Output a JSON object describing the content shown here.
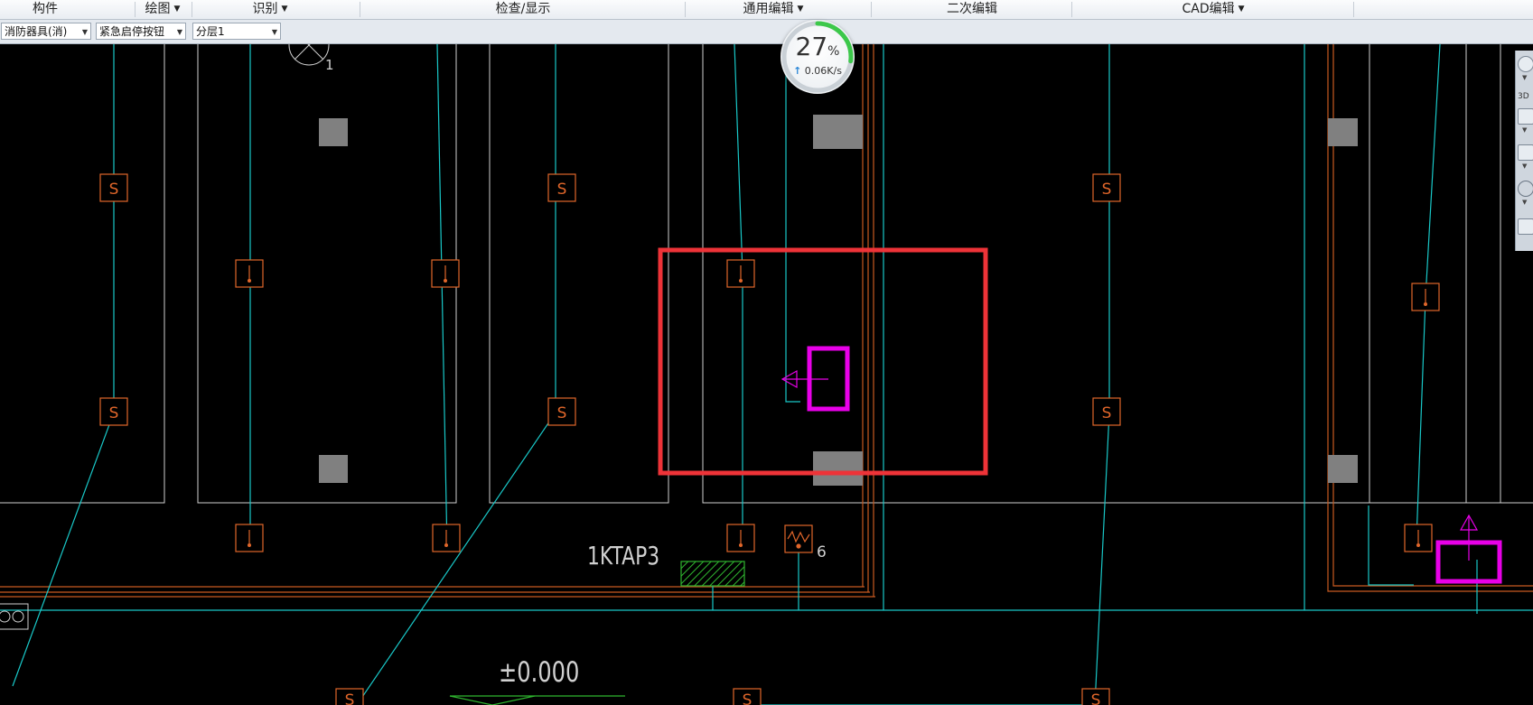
{
  "menubar": {
    "items": [
      {
        "label": "构件",
        "has_arrow": false
      },
      {
        "label": "绘图",
        "has_arrow": true
      },
      {
        "label": "识别",
        "has_arrow": true
      },
      {
        "label": "检查/显示",
        "has_arrow": false
      },
      {
        "label": "通用编辑",
        "has_arrow": true
      },
      {
        "label": "二次编辑",
        "has_arrow": false
      },
      {
        "label": "CAD编辑",
        "has_arrow": true
      }
    ]
  },
  "toolbar": {
    "component_type": "消防器具(消)",
    "component_name": "紧急启停按钮",
    "layer": "分层1"
  },
  "network_widget": {
    "percent": "27",
    "percent_unit": "%",
    "upload_speed": "0.06K/s"
  },
  "right_panel": {
    "label_3d": "3D"
  },
  "drawing": {
    "labels": {
      "panel_tag": "1KTAP3",
      "elevation": "±0.000",
      "index_number": "6",
      "axis_number": "1"
    },
    "symbols": {
      "speaker_letter": "S"
    }
  },
  "colors": {
    "canvas_bg": "#000000",
    "pipe_cyan": "#19c8c8",
    "wall_white": "#d0d0d0",
    "device_orange": "#e0662a",
    "column_gray": "#808080",
    "highlight_red": "#ee3338",
    "selection_magenta": "#e800e8",
    "panel_green": "#2fb52f",
    "wall_orange": "#c85a20",
    "ring_green": "#3cc84a"
  }
}
